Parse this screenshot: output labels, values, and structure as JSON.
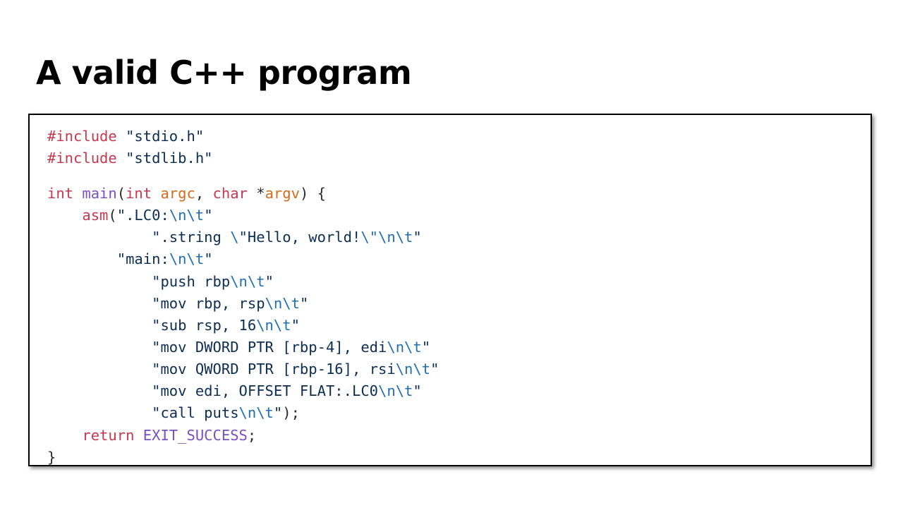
{
  "slide": {
    "title": "A valid C++ program"
  },
  "code": {
    "line1": {
      "directive": "#include",
      "sp": " ",
      "str": "\"stdio.h\""
    },
    "line2": {
      "directive": "#include",
      "sp": " ",
      "str": "\"stdlib.h\""
    },
    "line3": {
      "t_int": "int",
      "sp1": " ",
      "fn": "main",
      "p1": "(",
      "t_int2": "int",
      "sp2": " ",
      "argc": "argc",
      "comma": ", ",
      "t_char": "char",
      "sp3": " ",
      "star": "*",
      "argv": "argv",
      "close": ") {"
    },
    "line4": {
      "indent": "    ",
      "fn": "asm",
      "open": "(",
      "str": "\".LC0:",
      "esc": "\\n\\t",
      "q": "\""
    },
    "line5": {
      "indent": "            ",
      "str1": "\".string ",
      "esc1": "\\",
      "str2": "\"Hello, world!",
      "esc2": "\\\"\\n\\t",
      "q": "\""
    },
    "line6": {
      "indent": "        ",
      "str": "\"main:",
      "esc": "\\n\\t",
      "q": "\""
    },
    "line7": {
      "indent": "            ",
      "str": "\"push rbp",
      "esc": "\\n\\t",
      "q": "\""
    },
    "line8": {
      "indent": "            ",
      "str": "\"mov rbp, rsp",
      "esc": "\\n\\t",
      "q": "\""
    },
    "line9": {
      "indent": "            ",
      "str": "\"sub rsp, 16",
      "esc": "\\n\\t",
      "q": "\""
    },
    "line10": {
      "indent": "            ",
      "str": "\"mov DWORD PTR [rbp-4], edi",
      "esc": "\\n\\t",
      "q": "\""
    },
    "line11": {
      "indent": "            ",
      "str": "\"mov QWORD PTR [rbp-16], rsi",
      "esc": "\\n\\t",
      "q": "\""
    },
    "line12": {
      "indent": "            ",
      "str": "\"mov edi, OFFSET FLAT:.LC0",
      "esc": "\\n\\t",
      "q": "\""
    },
    "line13": {
      "indent": "            ",
      "str": "\"call puts",
      "esc": "\\n\\t",
      "q": "\"",
      "end": ");"
    },
    "line14": {
      "indent": "    ",
      "kw": "return",
      "sp": " ",
      "val": "EXIT_SUCCESS",
      "semi": ";"
    },
    "line15": {
      "brace": "}"
    }
  },
  "colors": {
    "keyword": "#c5394f",
    "function": "#7a4fbf",
    "parameter": "#d36b1b",
    "escape": "#1f6fb2",
    "string": "#0b2e52"
  }
}
